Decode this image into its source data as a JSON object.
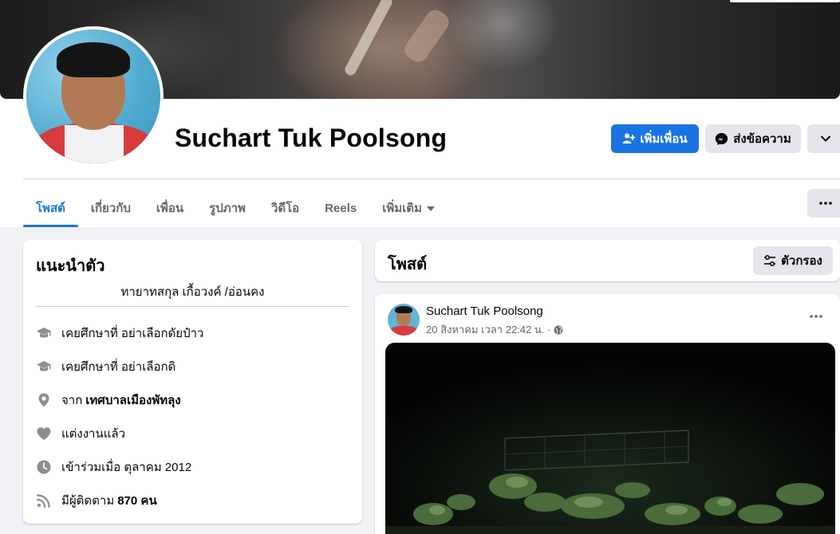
{
  "profile": {
    "name": "Suchart Tuk Poolsong"
  },
  "actions": {
    "add_friend_label": "เพิ่มเพื่อน",
    "message_label": "ส่งข้อความ"
  },
  "tabs": [
    {
      "label": "โพสต์",
      "active": true
    },
    {
      "label": "เกี่ยวกับ",
      "active": false
    },
    {
      "label": "เพื่อน",
      "active": false
    },
    {
      "label": "รูปภาพ",
      "active": false
    },
    {
      "label": "วิดีโอ",
      "active": false
    },
    {
      "label": "Reels",
      "active": false
    },
    {
      "label": "เพิ่มเติม",
      "active": false
    }
  ],
  "intro": {
    "title": "แนะนำตัว",
    "bio": "ทายาทสกุล เกื้อวงค์ /อ่อนคง",
    "items": [
      {
        "icon": "graduation-cap-icon",
        "prefix": "เคยศึกษาที่ อย่าเลือกดัยป๋าว",
        "bold": ""
      },
      {
        "icon": "graduation-cap-icon",
        "prefix": "เคยศึกษาที่ อย่าเลือกดิ",
        "bold": ""
      },
      {
        "icon": "location-pin-icon",
        "prefix": "จาก",
        "bold": "เทศบาลเมืองพัทลุง"
      },
      {
        "icon": "heart-icon",
        "prefix": "แต่งงานแล้ว",
        "bold": ""
      },
      {
        "icon": "clock-icon",
        "prefix": "เข้าร่วมเมื่อ ตุลาคม 2012",
        "bold": ""
      },
      {
        "icon": "rss-icon",
        "prefix": "มีผู้ติดตาม",
        "bold": "870 คน"
      }
    ]
  },
  "posts_header": {
    "title": "โพสต์",
    "filter_label": "ตัวกรอง"
  },
  "post": {
    "author": "Suchart Tuk Poolsong",
    "timestamp": "20 สิงหาคม เวลา 22:42 น. ·",
    "privacy_icon": "globe-icon"
  },
  "colors": {
    "accent": "#1b74e4",
    "button_gray": "#e4e6eb",
    "page_bg": "#f0f2f5",
    "secondary_text": "#65676b"
  }
}
